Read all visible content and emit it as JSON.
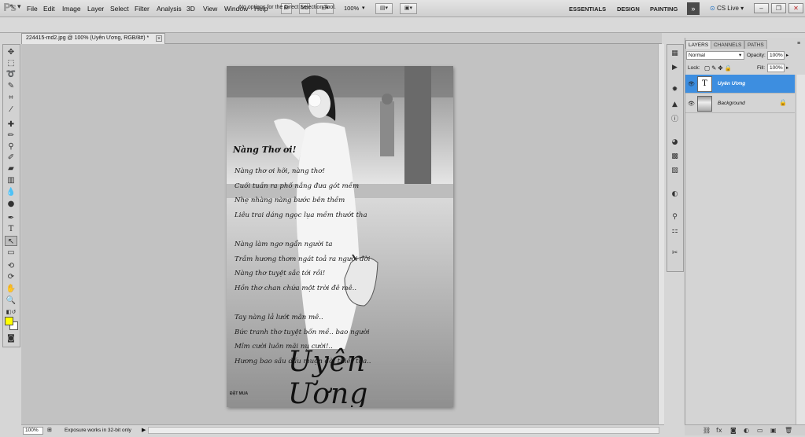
{
  "app": {
    "logo": "Ps"
  },
  "menu": [
    "File",
    "Edit",
    "Image",
    "Layer",
    "Select",
    "Filter",
    "Analysis",
    "3D",
    "View",
    "Window",
    "Help"
  ],
  "menubar_buttons": {
    "bridge": "Br",
    "minibridge": "Mb",
    "zoom": "100%"
  },
  "workspaces": [
    "ESSENTIALS",
    "DESIGN",
    "PAINTING"
  ],
  "cslive": "CS Live",
  "window_controls": {
    "minimize": "–",
    "restore": "❐",
    "close": "✕"
  },
  "options_bar": {
    "message": "No options for the Direct Selection Tool."
  },
  "document": {
    "tab_title": "224415-md2.jpg @ 100% (Uyên Ương, RGB/8#) *",
    "close": "×"
  },
  "poem": {
    "heading": "Nàng Thơ ơi!",
    "lines": [
      "Nàng thơ ơi hỡi, nàng thơ!",
      "Cuối tuần ra phố nắng đưa gót mềm",
      "Nhẹ nhàng nàng bước bên thềm",
      "Liêu trai dáng ngọc lụa mềm thướt tha",
      "",
      "Nàng làm ngơ ngẩn người ta",
      "Trầm hương thơm ngát toả ra người đời",
      "Nàng thơ tuyệt sắc tới rồi!",
      "Hồn thơ chan chứa một trời đê mê..",
      "",
      "Tay nàng lả lướt mân mê..",
      "Bức tranh thơ tuyệt bốn mề.. bao người",
      "Mỉm cười luôn mãi nụ cười!..",
      "Hương bao sầu dấu muộn đời thiết tha.."
    ],
    "signature": "Uyên Ương",
    "corner_mark": "ĐẶT MUA"
  },
  "statusbar": {
    "zoom": "100%",
    "message": "Exposure works in 32-bit only",
    "arrow": "▶"
  },
  "panel": {
    "tabs": [
      "LAYERS",
      "CHANNELS",
      "PATHS"
    ],
    "blend_mode": "Normal",
    "opacity_label": "Opacity:",
    "opacity_value": "100%",
    "lock_label": "Lock:",
    "fill_label": "Fill:",
    "fill_value": "100%",
    "layers": [
      {
        "name": "Uyên Ương",
        "thumb": "T",
        "selected": true
      },
      {
        "name": "Background",
        "thumb": "",
        "selected": false,
        "locked": true
      }
    ]
  },
  "colors": {
    "foreground": "#ffff00",
    "background": "#ffffff",
    "selection": "#3d8ee0"
  }
}
